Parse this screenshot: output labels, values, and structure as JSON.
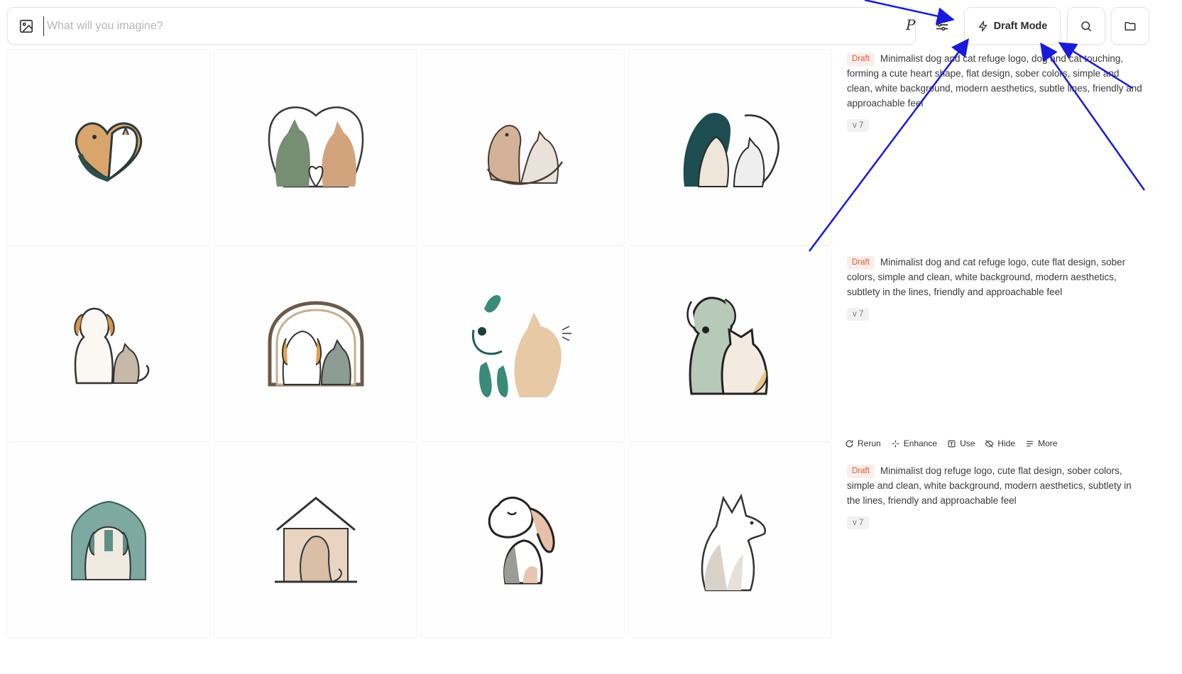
{
  "search": {
    "placeholder": "What will you imagine?"
  },
  "toolbar": {
    "personalize_label": "P",
    "draft_mode_label": "Draft Mode"
  },
  "icons": {
    "image": "image-icon",
    "sliders": "sliders-icon",
    "bolt": "bolt-icon",
    "search": "search-icon",
    "folder": "folder-icon"
  },
  "colors": {
    "badge_text": "#e05a3a",
    "badge_bg": "#fbeeea",
    "annotation_arrow": "#1a1adb"
  },
  "images": [
    {
      "subject": "dog and cat forming heart"
    },
    {
      "subject": "dog and cat inside heart"
    },
    {
      "subject": "sitting dog and cat"
    },
    {
      "subject": "teal dog and cat"
    },
    {
      "subject": "dog and cat sitting"
    },
    {
      "subject": "dog and cat in arch"
    },
    {
      "subject": "abstract teal dog and cat"
    },
    {
      "subject": "green dog and cat"
    },
    {
      "subject": "dog in teal house"
    },
    {
      "subject": "dog in wooden house"
    },
    {
      "subject": "dog with eyes closed"
    },
    {
      "subject": "white sitting dog"
    }
  ],
  "jobs": [
    {
      "badge": "Draft",
      "prompt": "Minimalist dog and cat refuge logo, dog and cat touching, forming a cute heart shape, flat design, sober colors, simple and clean, white background, modern aesthetics, subtle lines, friendly and approachable feel",
      "version": "v 7"
    },
    {
      "badge": "Draft",
      "prompt": "Minimalist dog and cat refuge logo, cute flat design, sober colors, simple and clean, white background, modern aesthetics, subtlety in the lines, friendly and approachable feel",
      "version": "v 7"
    },
    {
      "badge": "Draft",
      "prompt": "Minimalist dog refuge logo, cute flat design, sober colors, simple and clean, white background, modern aesthetics, subtlety in the lines, friendly and approachable feel",
      "version": "v 7"
    }
  ],
  "actions": {
    "rerun": "Rerun",
    "enhance": "Enhance",
    "use": "Use",
    "hide": "Hide",
    "more": "More"
  }
}
